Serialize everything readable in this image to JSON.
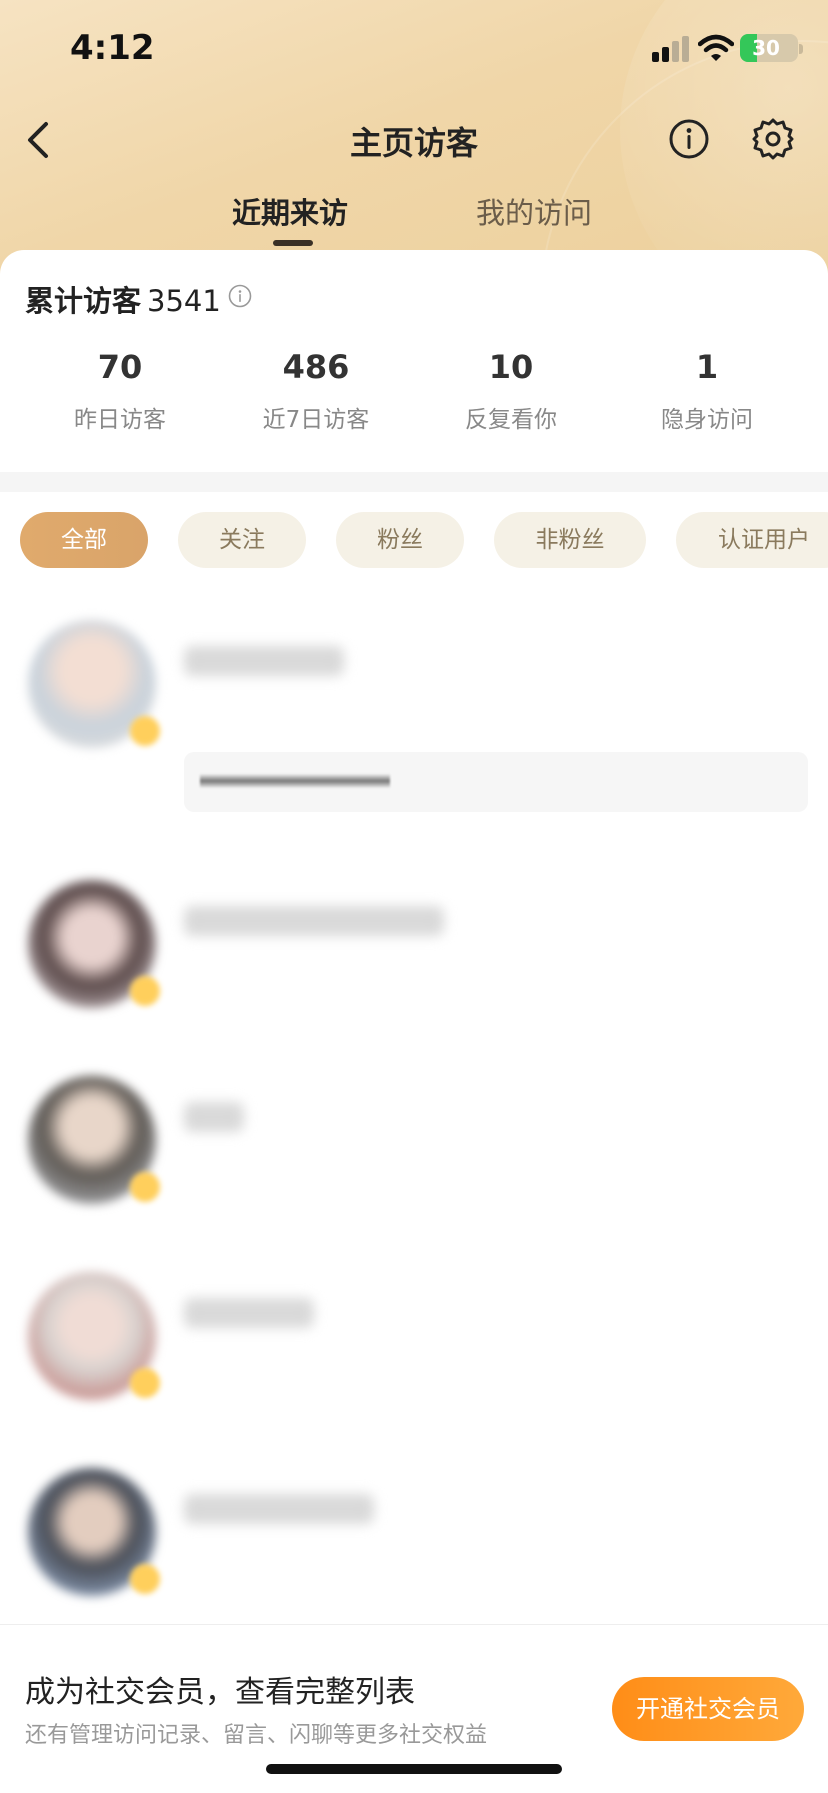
{
  "status_bar": {
    "time": "4:12",
    "battery": "30",
    "battery_level": 0.3
  },
  "nav": {
    "title": "主页访客",
    "icons": [
      "back-icon",
      "info-icon",
      "gear-icon"
    ]
  },
  "tabs": [
    {
      "label": "近期来访",
      "active": true
    },
    {
      "label": "我的访问",
      "active": false
    }
  ],
  "summary": {
    "total_label": "累计访客",
    "total_value": "3541",
    "stats": [
      {
        "value": "70",
        "label": "昨日访客"
      },
      {
        "value": "486",
        "label": "近7日访客"
      },
      {
        "value": "10",
        "label": "反复看你"
      },
      {
        "value": "1",
        "label": "隐身访问"
      }
    ]
  },
  "filters": [
    {
      "label": "全部",
      "active": true
    },
    {
      "label": "关注",
      "active": false
    },
    {
      "label": "粉丝",
      "active": false
    },
    {
      "label": "非粉丝",
      "active": false
    },
    {
      "label": "认证用户",
      "active": false
    }
  ],
  "promo": {
    "title": "成为社交会员，查看完整列表",
    "subtitle": "还有管理访问记录、留言、闪聊等更多社交权益",
    "button": "开通社交会员"
  },
  "colors": {
    "accent": "#d9a46a",
    "cta": "#ff9420",
    "chip_bg": "#f5f1e6",
    "battery_green": "#34c759"
  }
}
